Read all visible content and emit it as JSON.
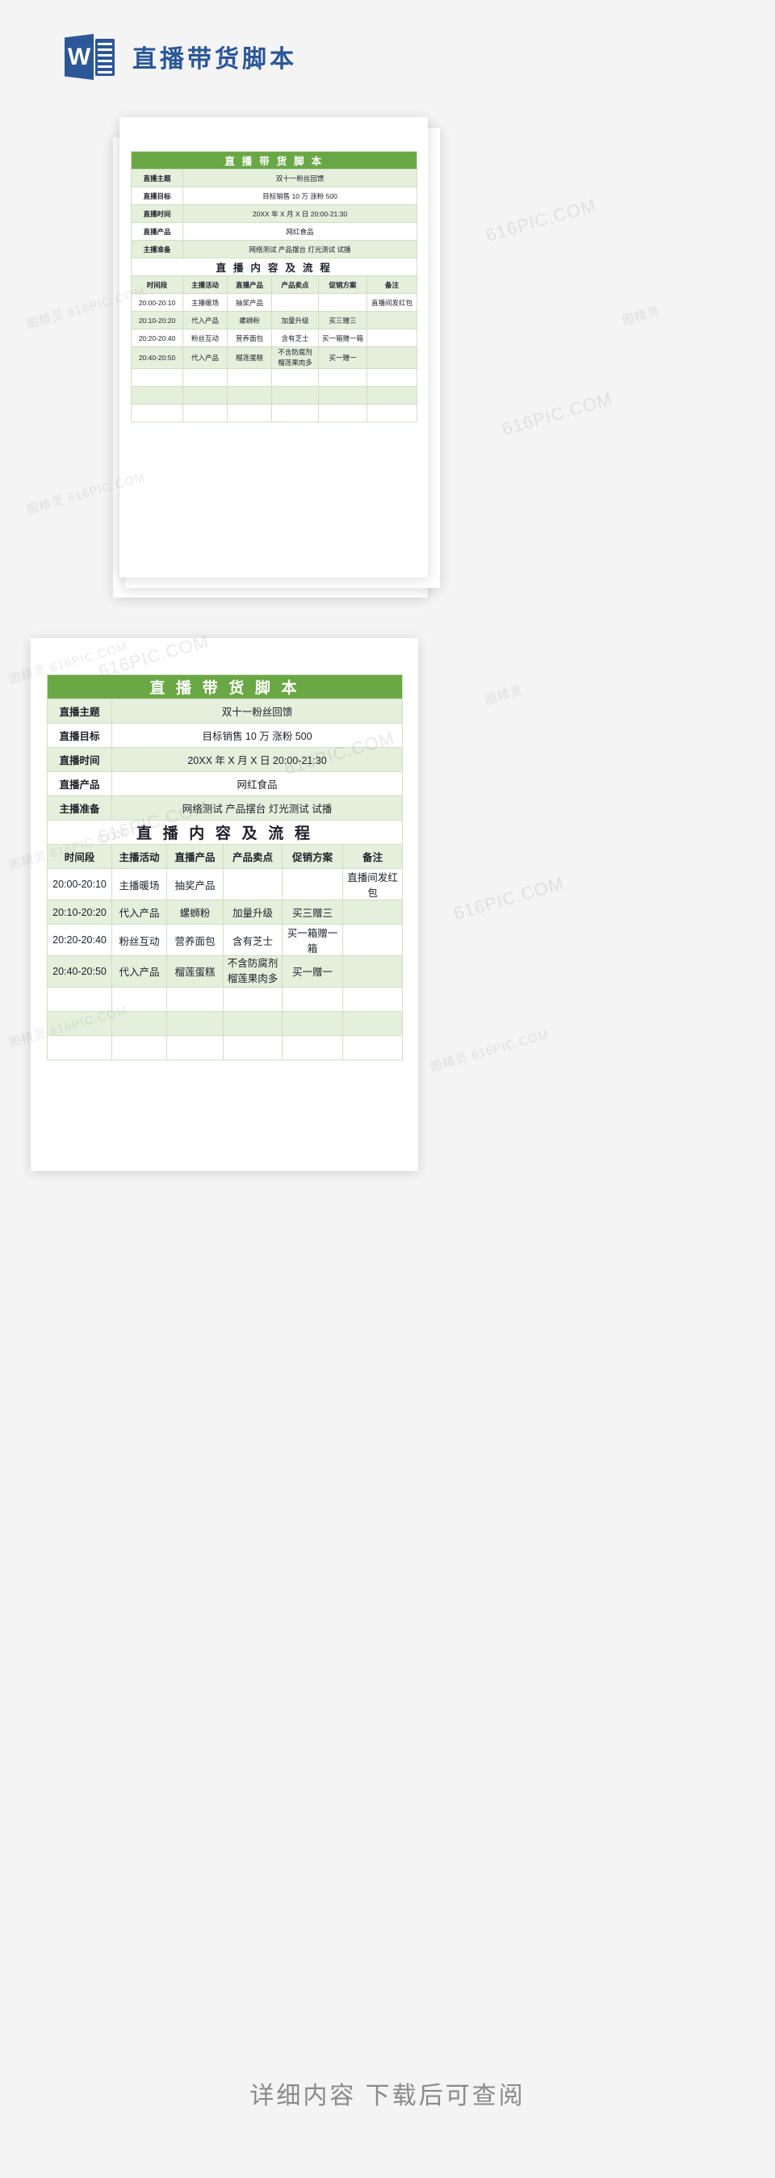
{
  "brand": {
    "app_icon": "word-icon",
    "icon_letter": "W",
    "title": "直播带货脚本",
    "accent_color": "#2b5797"
  },
  "document": {
    "header_title": "直 播 带 货 脚 本",
    "section_title": "直 播 内 容 及 流 程",
    "colors": {
      "header_green": "#6aa846",
      "row_light_green": "#e4efdc",
      "border": "#cfe0c0"
    },
    "info_rows": [
      {
        "label": "直播主题",
        "value": "双十一粉丝回馈"
      },
      {
        "label": "直播目标",
        "value": "目标销售 10 万  涨粉 500"
      },
      {
        "label": "直播时间",
        "value": "20XX 年 X 月 X 日 20:00-21:30"
      },
      {
        "label": "直播产品",
        "value": "网红食品"
      },
      {
        "label": "主播准备",
        "value": "网络测试  产品摆台  灯光测试  试播"
      }
    ],
    "table": {
      "columns": [
        "时间段",
        "主播活动",
        "直播产品",
        "产品卖点",
        "促销方案",
        "备注"
      ],
      "rows": [
        {
          "time": "20:00-20:10",
          "activity": "主播暖场",
          "product": "抽奖产品",
          "selling_point": "",
          "promotion": "",
          "note": "直播间发红包"
        },
        {
          "time": "20:10-20:20",
          "activity": "代入产品",
          "product": "螺蛳粉",
          "selling_point": "加量升级",
          "promotion": "买三赠三",
          "note": ""
        },
        {
          "time": "20:20-20:40",
          "activity": "粉丝互动",
          "product": "营养面包",
          "selling_point": "含有芝士",
          "promotion": "买一箱赠一箱",
          "note": ""
        },
        {
          "time": "20:40-20:50",
          "activity": "代入产品",
          "product": "榴莲蛋糕",
          "selling_point": "不含防腐剂 榴莲果肉多",
          "promotion": "买一赠一",
          "note": ""
        },
        {
          "time": "",
          "activity": "",
          "product": "",
          "selling_point": "",
          "promotion": "",
          "note": ""
        },
        {
          "time": "",
          "activity": "",
          "product": "",
          "selling_point": "",
          "promotion": "",
          "note": ""
        },
        {
          "time": "",
          "activity": "",
          "product": "",
          "selling_point": "",
          "promotion": "",
          "note": ""
        }
      ],
      "row4_note_line1": "不含防腐剂",
      "row4_note_line2": "榴莲果肉多"
    }
  },
  "watermarks": {
    "text_a": "图精灵 616PIC.COM",
    "text_b": "616PIC.COM",
    "text_c": "图精灵"
  },
  "footer": {
    "text": "详细内容 下载后可查阅"
  }
}
